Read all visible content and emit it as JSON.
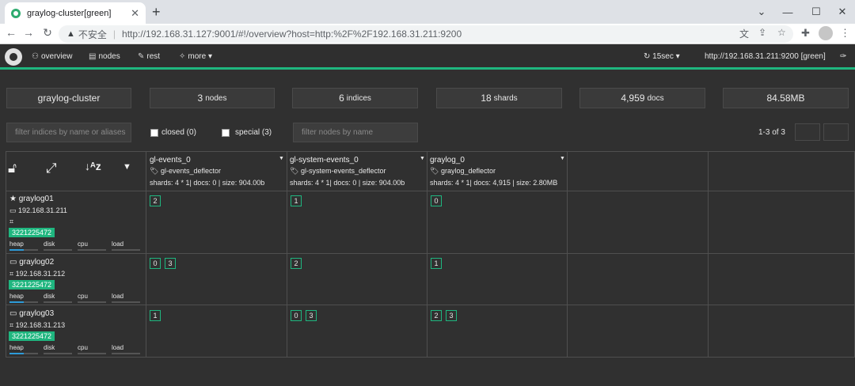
{
  "browser": {
    "tab_title": "graylog-cluster[green]",
    "security_label": "不安全",
    "url": "http://192.168.31.127:9001/#!/overview?host=http:%2F%2F192.168.31.211:9200"
  },
  "navbar": {
    "overview": "overview",
    "nodes": "nodes",
    "rest": "rest",
    "more": "more",
    "refresh": "15sec",
    "host": "http://192.168.31.211:9200 [green]"
  },
  "stats": {
    "cluster_name": "graylog-cluster",
    "nodes_count": "3",
    "nodes_label": "nodes",
    "indices_count": "6",
    "indices_label": "indices",
    "shards_count": "18",
    "shards_label": "shards",
    "docs_count": "4,959",
    "docs_label": "docs",
    "size": "84.58MB"
  },
  "filters": {
    "indices_placeholder": "filter indices by name or aliases",
    "closed_label": "closed (0)",
    "special_label": "special (3)",
    "nodes_placeholder": "filter nodes by name",
    "pager": "1-3 of 3"
  },
  "indices": [
    {
      "name": "gl-events_0",
      "alias": "gl-events_deflector",
      "meta": "shards: 4 * 1| docs: 0 | size: 904.00b"
    },
    {
      "name": "gl-system-events_0",
      "alias": "gl-system-events_deflector",
      "meta": "shards: 4 * 1| docs: 0 | size: 904.00b"
    },
    {
      "name": "graylog_0",
      "alias": "graylog_deflector",
      "meta": "shards: 4 * 1| docs: 4,915 | size: 2.80MB"
    }
  ],
  "nodes": [
    {
      "name": "graylog01",
      "ip": "192.168.31.211",
      "badge": "3221225472",
      "master": true,
      "shards": [
        [
          "2"
        ],
        [
          "1"
        ],
        [
          "0"
        ]
      ]
    },
    {
      "name": "graylog02",
      "ip": "192.168.31.212",
      "badge": "3221225472",
      "master": false,
      "shards": [
        [
          "0",
          "3"
        ],
        [
          "2"
        ],
        [
          "1"
        ]
      ]
    },
    {
      "name": "graylog03",
      "ip": "192.168.31.213",
      "badge": "3221225472",
      "master": false,
      "shards": [
        [
          "1"
        ],
        [
          "0",
          "3"
        ],
        [
          "2",
          "3"
        ]
      ]
    }
  ],
  "metrics": {
    "heap": "heap",
    "disk": "disk",
    "cpu": "cpu",
    "load": "load"
  }
}
